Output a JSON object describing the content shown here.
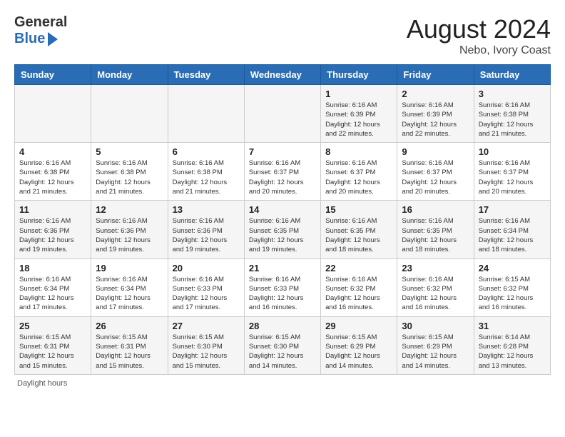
{
  "header": {
    "logo_general": "General",
    "logo_blue": "Blue",
    "month_title": "August 2024",
    "location": "Nebo, Ivory Coast"
  },
  "days_of_week": [
    "Sunday",
    "Monday",
    "Tuesday",
    "Wednesday",
    "Thursday",
    "Friday",
    "Saturday"
  ],
  "weeks": [
    [
      {
        "day": "",
        "info": ""
      },
      {
        "day": "",
        "info": ""
      },
      {
        "day": "",
        "info": ""
      },
      {
        "day": "",
        "info": ""
      },
      {
        "day": "1",
        "info": "Sunrise: 6:16 AM\nSunset: 6:39 PM\nDaylight: 12 hours\nand 22 minutes."
      },
      {
        "day": "2",
        "info": "Sunrise: 6:16 AM\nSunset: 6:39 PM\nDaylight: 12 hours\nand 22 minutes."
      },
      {
        "day": "3",
        "info": "Sunrise: 6:16 AM\nSunset: 6:38 PM\nDaylight: 12 hours\nand 21 minutes."
      }
    ],
    [
      {
        "day": "4",
        "info": "Sunrise: 6:16 AM\nSunset: 6:38 PM\nDaylight: 12 hours\nand 21 minutes."
      },
      {
        "day": "5",
        "info": "Sunrise: 6:16 AM\nSunset: 6:38 PM\nDaylight: 12 hours\nand 21 minutes."
      },
      {
        "day": "6",
        "info": "Sunrise: 6:16 AM\nSunset: 6:38 PM\nDaylight: 12 hours\nand 21 minutes."
      },
      {
        "day": "7",
        "info": "Sunrise: 6:16 AM\nSunset: 6:37 PM\nDaylight: 12 hours\nand 20 minutes."
      },
      {
        "day": "8",
        "info": "Sunrise: 6:16 AM\nSunset: 6:37 PM\nDaylight: 12 hours\nand 20 minutes."
      },
      {
        "day": "9",
        "info": "Sunrise: 6:16 AM\nSunset: 6:37 PM\nDaylight: 12 hours\nand 20 minutes."
      },
      {
        "day": "10",
        "info": "Sunrise: 6:16 AM\nSunset: 6:37 PM\nDaylight: 12 hours\nand 20 minutes."
      }
    ],
    [
      {
        "day": "11",
        "info": "Sunrise: 6:16 AM\nSunset: 6:36 PM\nDaylight: 12 hours\nand 19 minutes."
      },
      {
        "day": "12",
        "info": "Sunrise: 6:16 AM\nSunset: 6:36 PM\nDaylight: 12 hours\nand 19 minutes."
      },
      {
        "day": "13",
        "info": "Sunrise: 6:16 AM\nSunset: 6:36 PM\nDaylight: 12 hours\nand 19 minutes."
      },
      {
        "day": "14",
        "info": "Sunrise: 6:16 AM\nSunset: 6:35 PM\nDaylight: 12 hours\nand 19 minutes."
      },
      {
        "day": "15",
        "info": "Sunrise: 6:16 AM\nSunset: 6:35 PM\nDaylight: 12 hours\nand 18 minutes."
      },
      {
        "day": "16",
        "info": "Sunrise: 6:16 AM\nSunset: 6:35 PM\nDaylight: 12 hours\nand 18 minutes."
      },
      {
        "day": "17",
        "info": "Sunrise: 6:16 AM\nSunset: 6:34 PM\nDaylight: 12 hours\nand 18 minutes."
      }
    ],
    [
      {
        "day": "18",
        "info": "Sunrise: 6:16 AM\nSunset: 6:34 PM\nDaylight: 12 hours\nand 17 minutes."
      },
      {
        "day": "19",
        "info": "Sunrise: 6:16 AM\nSunset: 6:34 PM\nDaylight: 12 hours\nand 17 minutes."
      },
      {
        "day": "20",
        "info": "Sunrise: 6:16 AM\nSunset: 6:33 PM\nDaylight: 12 hours\nand 17 minutes."
      },
      {
        "day": "21",
        "info": "Sunrise: 6:16 AM\nSunset: 6:33 PM\nDaylight: 12 hours\nand 16 minutes."
      },
      {
        "day": "22",
        "info": "Sunrise: 6:16 AM\nSunset: 6:32 PM\nDaylight: 12 hours\nand 16 minutes."
      },
      {
        "day": "23",
        "info": "Sunrise: 6:16 AM\nSunset: 6:32 PM\nDaylight: 12 hours\nand 16 minutes."
      },
      {
        "day": "24",
        "info": "Sunrise: 6:15 AM\nSunset: 6:32 PM\nDaylight: 12 hours\nand 16 minutes."
      }
    ],
    [
      {
        "day": "25",
        "info": "Sunrise: 6:15 AM\nSunset: 6:31 PM\nDaylight: 12 hours\nand 15 minutes."
      },
      {
        "day": "26",
        "info": "Sunrise: 6:15 AM\nSunset: 6:31 PM\nDaylight: 12 hours\nand 15 minutes."
      },
      {
        "day": "27",
        "info": "Sunrise: 6:15 AM\nSunset: 6:30 PM\nDaylight: 12 hours\nand 15 minutes."
      },
      {
        "day": "28",
        "info": "Sunrise: 6:15 AM\nSunset: 6:30 PM\nDaylight: 12 hours\nand 14 minutes."
      },
      {
        "day": "29",
        "info": "Sunrise: 6:15 AM\nSunset: 6:29 PM\nDaylight: 12 hours\nand 14 minutes."
      },
      {
        "day": "30",
        "info": "Sunrise: 6:15 AM\nSunset: 6:29 PM\nDaylight: 12 hours\nand 14 minutes."
      },
      {
        "day": "31",
        "info": "Sunrise: 6:14 AM\nSunset: 6:28 PM\nDaylight: 12 hours\nand 13 minutes."
      }
    ]
  ],
  "footer": {
    "daylight_hours_label": "Daylight hours"
  }
}
